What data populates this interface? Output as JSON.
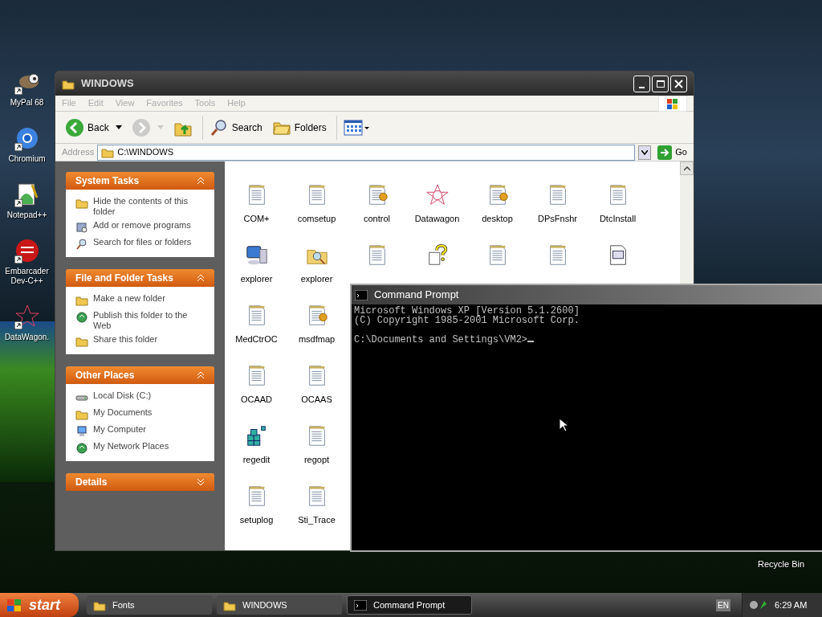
{
  "desktop_icons": [
    {
      "label": "MyPal 68",
      "kind": "raccoon"
    },
    {
      "label": "Chromium",
      "kind": "browser"
    },
    {
      "label": "Notepad++",
      "kind": "editor"
    },
    {
      "label": "Embarcader Dev-C++",
      "kind": "dev"
    },
    {
      "label": "DataWagon.",
      "kind": "star"
    }
  ],
  "recycle_bin": {
    "label": "Recycle Bin"
  },
  "explorer": {
    "title": "WINDOWS",
    "menu": [
      "File",
      "Edit",
      "View",
      "Favorites",
      "Tools",
      "Help"
    ],
    "toolbar": [
      {
        "label": "Back",
        "kind": "back",
        "disabled": false
      },
      {
        "kind": "forward",
        "disabled": true
      },
      {
        "kind": "up",
        "disabled": false
      },
      {
        "label": "Search",
        "kind": "search",
        "disabled": false
      },
      {
        "label": "Folders",
        "kind": "folders",
        "disabled": false
      },
      {
        "kind": "views",
        "disabled": false
      }
    ],
    "address": {
      "label": "Address",
      "value": "C:\\WINDOWS",
      "go": "Go"
    },
    "task_sections": [
      {
        "title": "System Tasks",
        "expanded": true,
        "items": [
          {
            "label": "Hide the contents of this folder",
            "kind": "folder"
          },
          {
            "label": "Add or remove programs",
            "kind": "programs"
          },
          {
            "label": "Search for files or folders",
            "kind": "search"
          }
        ]
      },
      {
        "title": "File and Folder Tasks",
        "expanded": true,
        "items": [
          {
            "label": "Make a new folder",
            "kind": "folder"
          },
          {
            "label": "Publish this folder to the Web",
            "kind": "globe"
          },
          {
            "label": "Share this folder",
            "kind": "folder"
          }
        ]
      },
      {
        "title": "Other Places",
        "expanded": true,
        "items": [
          {
            "label": "Local Disk (C:)",
            "kind": "disk"
          },
          {
            "label": "My Documents",
            "kind": "folder"
          },
          {
            "label": "My Computer",
            "kind": "computer"
          },
          {
            "label": "My Network Places",
            "kind": "globe"
          }
        ]
      },
      {
        "title": "Details",
        "expanded": false
      }
    ],
    "file_rows": [
      [
        {
          "label": "COM+",
          "kind": "text"
        },
        {
          "label": "comsetup",
          "kind": "text"
        },
        {
          "label": "control",
          "kind": "config"
        },
        {
          "label": "Datawagon",
          "kind": "star"
        },
        {
          "label": "desktop",
          "kind": "config"
        },
        {
          "label": "DPsFnshr",
          "kind": "text"
        },
        {
          "label": "DtcInstall",
          "kind": "text"
        }
      ],
      [
        {
          "label": "explorer",
          "kind": "computer"
        },
        {
          "label": "explorer",
          "kind": "searchfolder"
        },
        {
          "kind": "text"
        },
        {
          "kind": "help"
        },
        {
          "kind": "text"
        },
        {
          "kind": "text"
        },
        {
          "kind": "window"
        }
      ],
      [
        {
          "label": "MedCtrOC",
          "kind": "text"
        },
        {
          "label": "msdfmap",
          "kind": "config"
        }
      ],
      [
        {
          "label": "OCAAD",
          "kind": "text"
        },
        {
          "label": "OCAAS",
          "kind": "text"
        }
      ],
      [
        {
          "label": "regedit",
          "kind": "registry"
        },
        {
          "label": "regopt",
          "kind": "text"
        }
      ],
      [
        {
          "label": "setuplog",
          "kind": "text"
        },
        {
          "label": "Sti_Trace",
          "kind": "text"
        }
      ]
    ]
  },
  "command_prompt": {
    "title": "Command Prompt",
    "lines": [
      "Microsoft Windows XP [Version 5.1.2600]",
      "(C) Copyright 1985-2001 Microsoft Corp.",
      "C:\\Documents and Settings\\VM2>"
    ]
  },
  "taskbar": {
    "start": "start",
    "tasks": [
      {
        "label": "Fonts",
        "kind": "folder",
        "selected": false
      },
      {
        "label": "WINDOWS",
        "kind": "folder",
        "selected": false
      },
      {
        "label": "Command Prompt",
        "kind": "console",
        "selected": true
      }
    ],
    "language": "EN",
    "time": "6:29 AM"
  }
}
